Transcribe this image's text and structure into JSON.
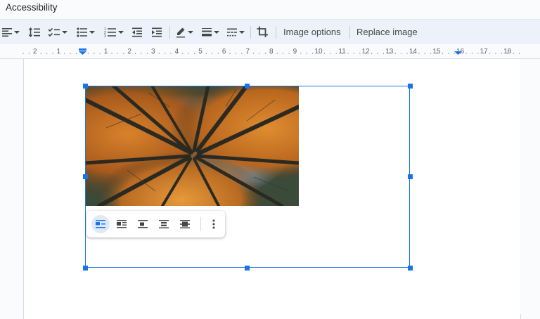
{
  "menubar": {
    "accessibility_label": "Accessibility"
  },
  "toolbar": {
    "image_options_label": "Image options",
    "replace_image_label": "Replace image",
    "icons": [
      "align-left-icon",
      "line-spacing-icon",
      "checklist-icon",
      "bulleted-list-icon",
      "numbered-list-icon",
      "decrease-indent-icon",
      "increase-indent-icon",
      "border-color-icon",
      "border-weight-icon",
      "border-dash-icon",
      "crop-icon"
    ]
  },
  "ruler": {
    "labels": [
      "2",
      "1",
      "1",
      "2",
      "3",
      "4",
      "5",
      "6",
      "7",
      "8",
      "9",
      "10",
      "11",
      "12",
      "13",
      "14",
      "15",
      "16",
      "17",
      "18"
    ]
  },
  "image_wrap_toolbar": {
    "options": [
      "inline-icon",
      "wrap-text-icon",
      "break-text-icon",
      "behind-text-icon",
      "in-front-of-text-icon",
      "more-options-icon"
    ],
    "selected": "inline"
  },
  "colors": {
    "accent": "#1a73e8",
    "toolbar_bg": "#edf2fa",
    "page_bg": "#ffffff"
  }
}
